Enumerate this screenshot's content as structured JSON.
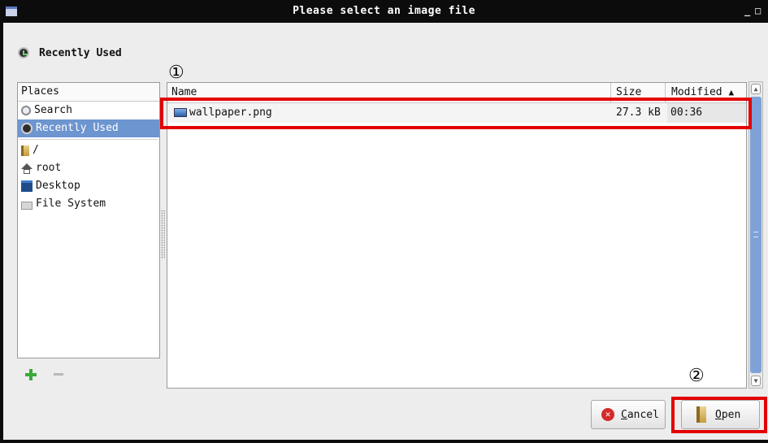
{
  "window": {
    "title": "Please select an image file",
    "minimize": "_",
    "maximize": "□"
  },
  "location": {
    "label": "Recently Used"
  },
  "places": {
    "header": "Places",
    "items": [
      {
        "label": "Search",
        "icon": "search-icon",
        "selected": false
      },
      {
        "label": "Recently Used",
        "icon": "recently-used-icon",
        "selected": true
      },
      {
        "label": "/",
        "icon": "folder-icon",
        "selected": false
      },
      {
        "label": "root",
        "icon": "home-icon",
        "selected": false
      },
      {
        "label": "Desktop",
        "icon": "desktop-icon",
        "selected": false
      },
      {
        "label": "File System",
        "icon": "drive-icon",
        "selected": false
      }
    ],
    "add_icon": "add-icon",
    "remove_icon": "remove-icon"
  },
  "files": {
    "columns": {
      "name": "Name",
      "size": "Size",
      "modified": "Modified"
    },
    "sort_indicator": "ascending",
    "rows": [
      {
        "name": "wallpaper.png",
        "size": "27.3 kB",
        "modified": "00:36",
        "icon": "image-file-icon"
      }
    ]
  },
  "buttons": {
    "cancel": "Cancel",
    "open": "Open"
  },
  "annotations": {
    "marker_1": "①",
    "marker_2": "②",
    "highlight_color": "#e40000"
  },
  "colors": {
    "selection": "#6d95cf",
    "titlebar": "#0c0c0c"
  }
}
